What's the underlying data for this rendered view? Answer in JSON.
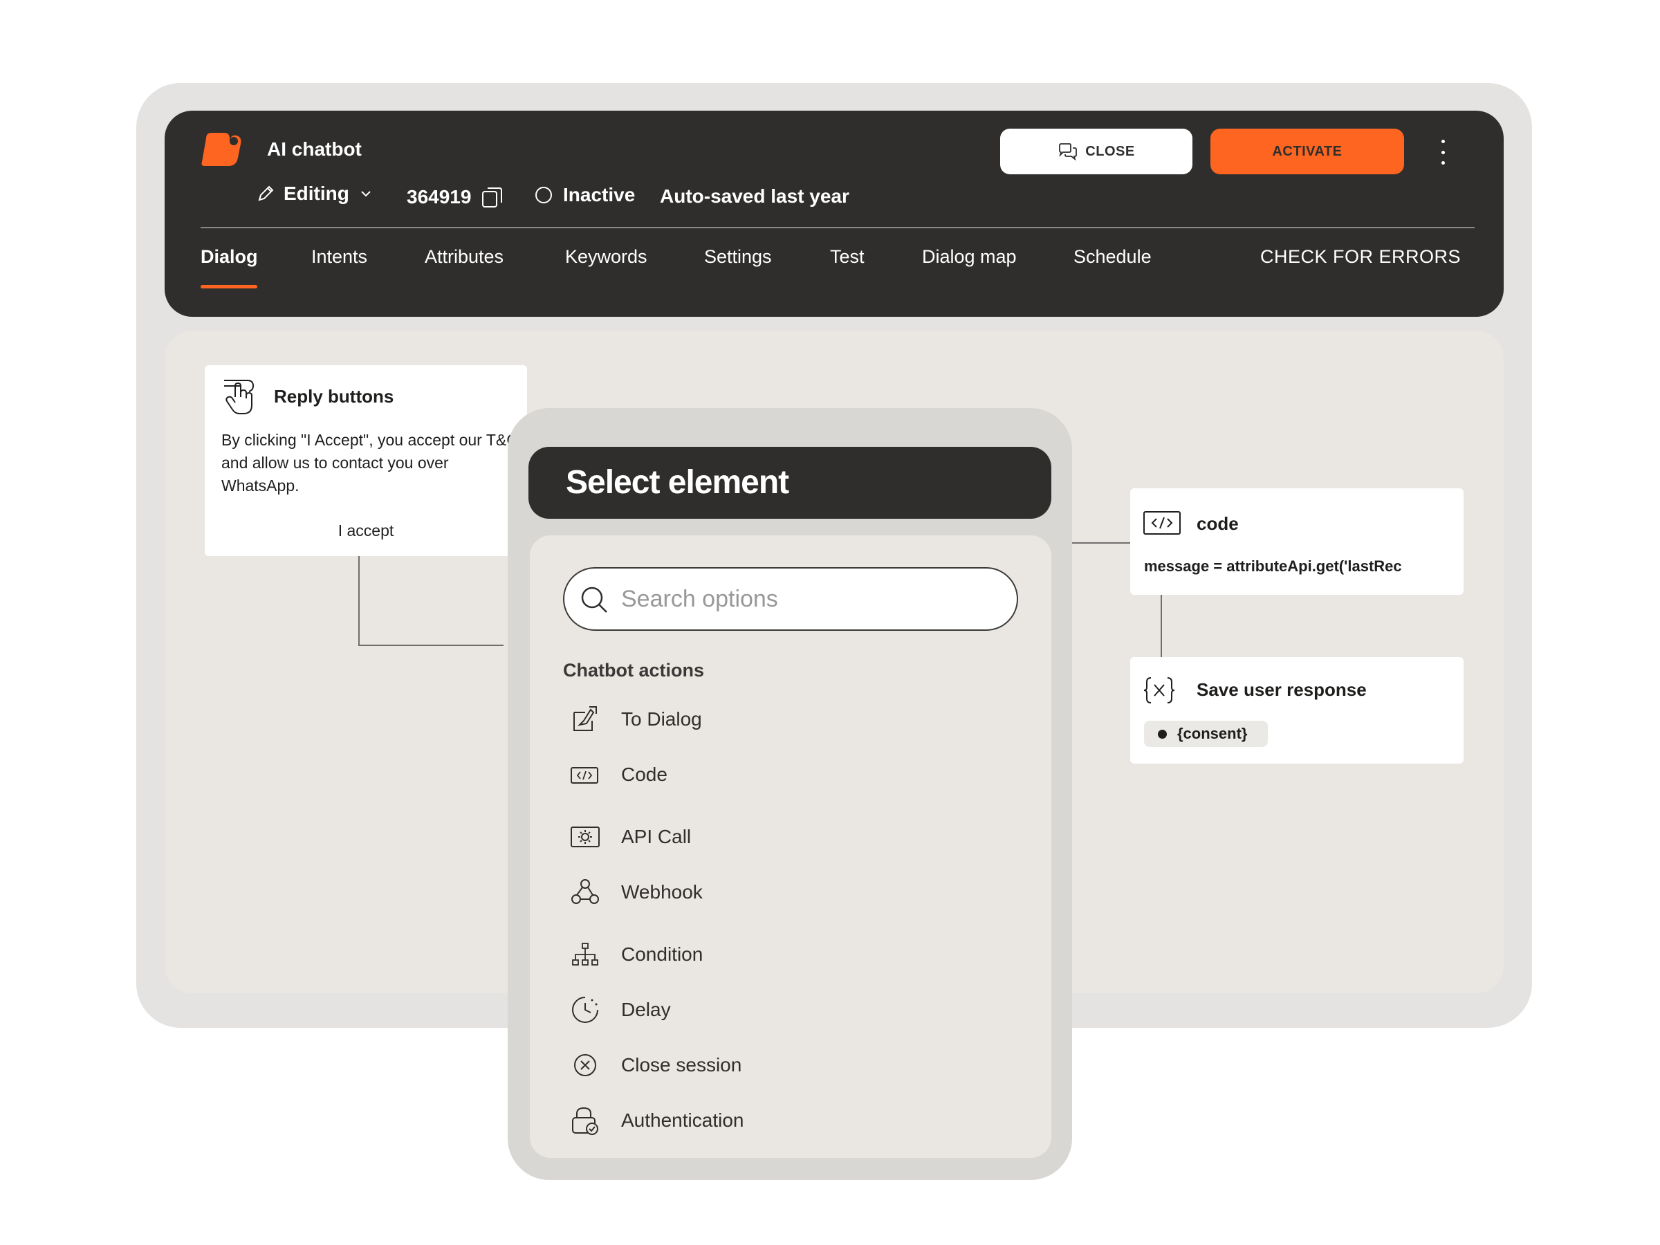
{
  "header": {
    "app_title": "AI chatbot",
    "mode": "Editing",
    "bot_id": "364919",
    "status": "Inactive",
    "autosave": "Auto-saved last year",
    "close_label": "CLOSE",
    "activate_label": "ACTIVATE",
    "check_errors": "CHECK FOR ERRORS",
    "accent_color": "#fd6521"
  },
  "tabs": [
    {
      "label": "Dialog",
      "active": true
    },
    {
      "label": "Intents"
    },
    {
      "label": "Attributes"
    },
    {
      "label": "Keywords"
    },
    {
      "label": "Settings"
    },
    {
      "label": "Test"
    },
    {
      "label": "Dialog map"
    },
    {
      "label": "Schedule"
    }
  ],
  "canvas": {
    "reply_card": {
      "icon": "tap-hand-icon",
      "title": "Reply buttons",
      "body": "By clicking \"I Accept\", you accept our T&C and allow us to contact you over WhatsApp.",
      "button": "I accept"
    },
    "code_card": {
      "icon": "code-icon",
      "title": "code",
      "body": "message = attributeApi.get('lastRec"
    },
    "save_card": {
      "icon": "variable-icon",
      "title": "Save user response",
      "badge": "{consent}"
    }
  },
  "panel": {
    "title": "Select element",
    "search_placeholder": "Search options",
    "section": "Chatbot actions",
    "options": [
      {
        "label": "To Dialog",
        "icon": "to-dialog-icon"
      },
      {
        "label": "Code",
        "icon": "code-icon"
      },
      {
        "label": "API Call",
        "icon": "api-gear-icon"
      },
      {
        "label": "Webhook",
        "icon": "webhook-icon"
      },
      {
        "label": "Condition",
        "icon": "hierarchy-icon"
      },
      {
        "label": "Delay",
        "icon": "clock-icon"
      },
      {
        "label": "Close session",
        "icon": "close-circle-icon"
      },
      {
        "label": "Authentication",
        "icon": "lock-check-icon"
      }
    ]
  }
}
